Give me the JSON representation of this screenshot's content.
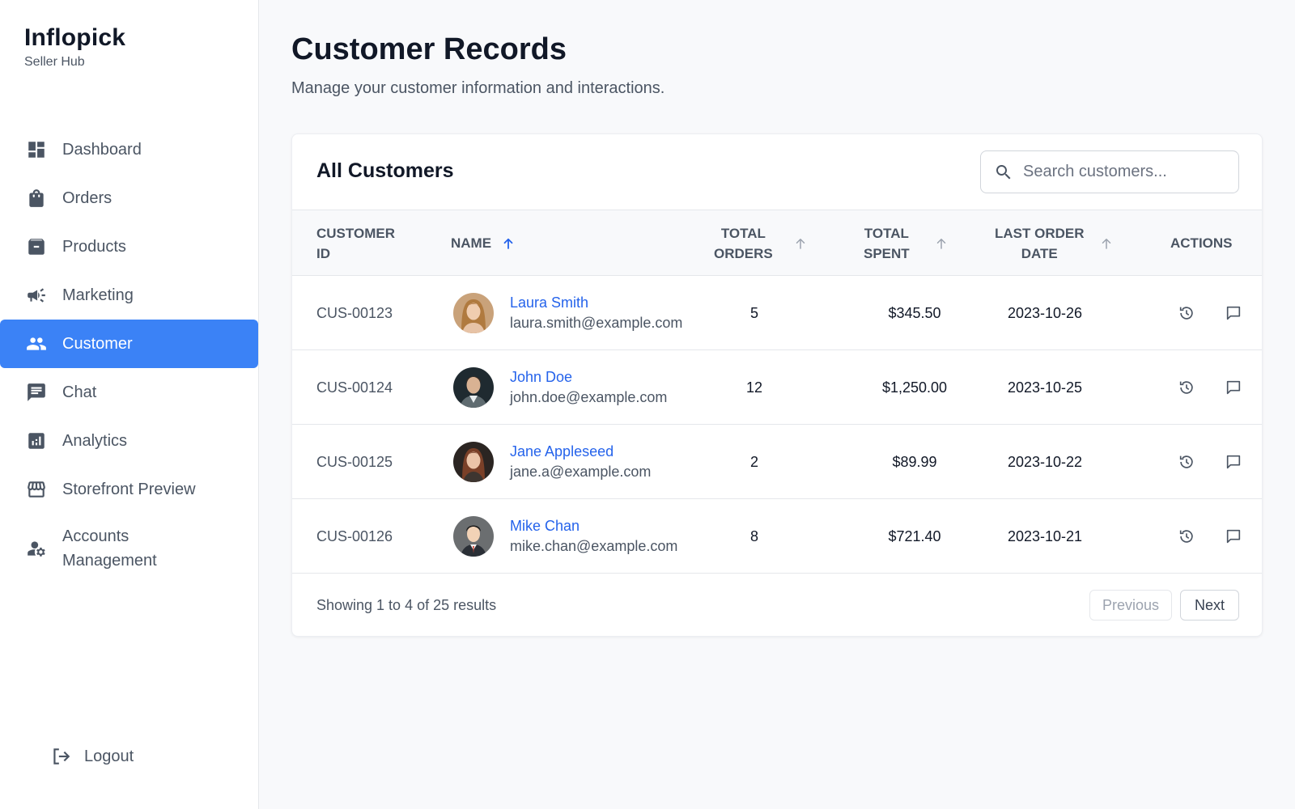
{
  "brand": {
    "name": "Inflopick",
    "subtitle": "Seller Hub"
  },
  "nav": {
    "items": [
      {
        "label": "Dashboard",
        "icon": "dashboard-icon",
        "active": false
      },
      {
        "label": "Orders",
        "icon": "shopping-bag-icon",
        "active": false
      },
      {
        "label": "Products",
        "icon": "archive-box-icon",
        "active": false
      },
      {
        "label": "Marketing",
        "icon": "megaphone-icon",
        "active": false
      },
      {
        "label": "Customer",
        "icon": "people-icon",
        "active": true
      },
      {
        "label": "Chat",
        "icon": "chat-icon",
        "active": false
      },
      {
        "label": "Analytics",
        "icon": "analytics-icon",
        "active": false
      },
      {
        "label": "Storefront Preview",
        "icon": "storefront-icon",
        "active": false
      },
      {
        "label": "Accounts\nManagement",
        "icon": "user-gear-icon",
        "active": false
      }
    ],
    "logout": "Logout"
  },
  "page": {
    "title": "Customer Records",
    "subtitle": "Manage your customer information and interactions."
  },
  "card": {
    "title": "All Customers",
    "search_placeholder": "Search customers..."
  },
  "table": {
    "headers": {
      "customer_id": "CUSTOMER\nID",
      "name": "NAME",
      "total_orders": "TOTAL\nORDERS",
      "total_spent": "TOTAL\nSPENT",
      "last_order_date": "LAST ORDER\nDATE",
      "actions": "ACTIONS"
    },
    "sort": {
      "active_column": "name",
      "direction": "ascending"
    },
    "rows": [
      {
        "id": "CUS-00123",
        "name": "Laura Smith",
        "email": "laura.smith@example.com",
        "orders": "5",
        "spent": "$345.50",
        "date": "2023-10-26"
      },
      {
        "id": "CUS-00124",
        "name": "John Doe",
        "email": "john.doe@example.com",
        "orders": "12",
        "spent": "$1,250.00",
        "date": "2023-10-25"
      },
      {
        "id": "CUS-00125",
        "name": "Jane Appleseed",
        "email": "jane.a@example.com",
        "orders": "2",
        "spent": "$89.99",
        "date": "2023-10-22"
      },
      {
        "id": "CUS-00126",
        "name": "Mike Chan",
        "email": "mike.chan@example.com",
        "orders": "8",
        "spent": "$721.40",
        "date": "2023-10-21"
      }
    ],
    "row_actions": [
      "history-icon",
      "message-icon"
    ]
  },
  "footer": {
    "results": "Showing 1 to 4 of 25 results",
    "previous": "Previous",
    "next": "Next"
  },
  "colors": {
    "accent": "#3b82f6",
    "link": "#2563eb",
    "text": "#111827",
    "muted": "#4b5563",
    "background": "#f8f9fb"
  }
}
